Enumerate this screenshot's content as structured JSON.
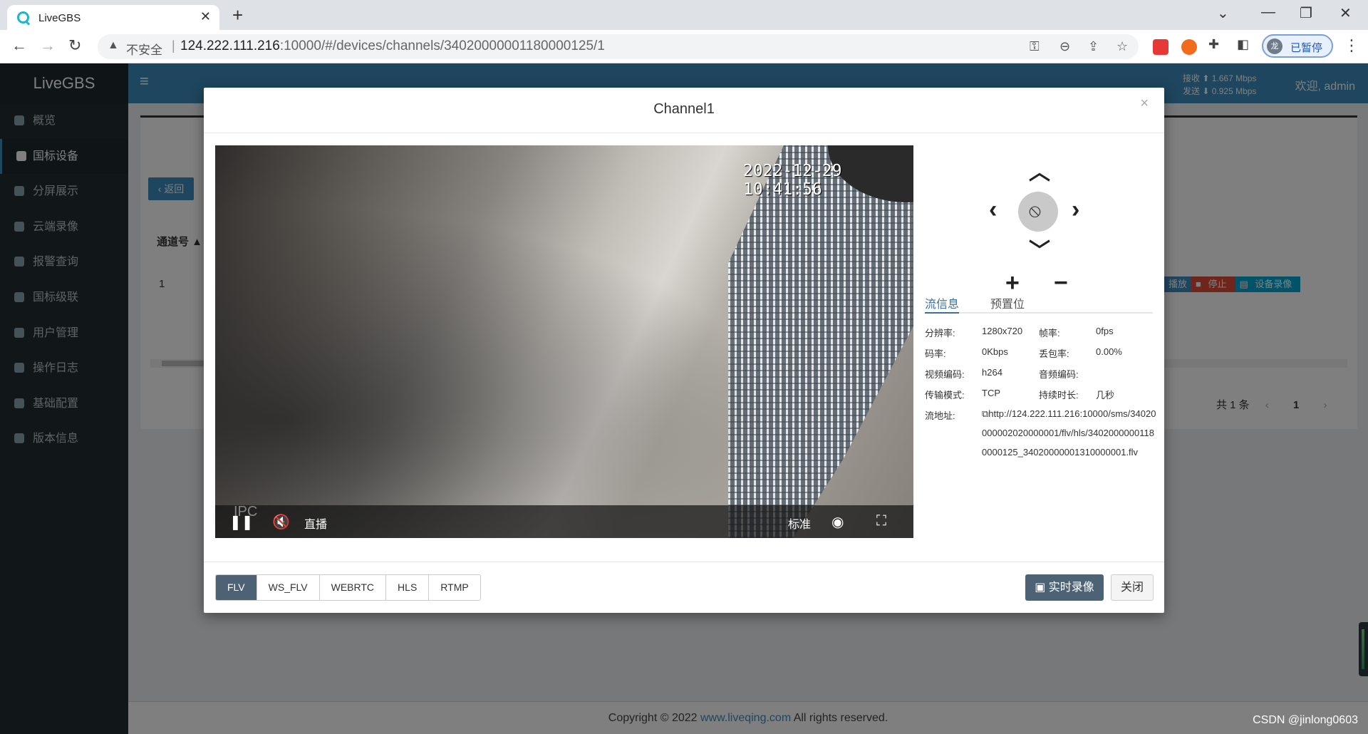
{
  "browser": {
    "tab_title": "LiveGBS",
    "insecure_label": "不安全",
    "url_host": "124.222.111.216",
    "url_rest": ":10000/#/devices/channels/34020000001180000125/1",
    "profile_initial": "龙",
    "profile_label": "已暂停"
  },
  "app": {
    "brand": "LiveGBS",
    "menu": [
      {
        "label": "概览",
        "icon": "dashboard-icon"
      },
      {
        "label": "国标设备",
        "icon": "video-camera-icon",
        "active": true
      },
      {
        "label": "分屏展示",
        "icon": "grid-icon"
      },
      {
        "label": "云端录像",
        "icon": "cloud-icon"
      },
      {
        "label": "报警查询",
        "icon": "bell-icon"
      },
      {
        "label": "国标级联",
        "icon": "cloud-upload-icon"
      },
      {
        "label": "用户管理",
        "icon": "users-icon"
      },
      {
        "label": "操作日志",
        "icon": "file-icon"
      },
      {
        "label": "基础配置",
        "icon": "cogs-icon"
      },
      {
        "label": "版本信息",
        "icon": "globe-icon"
      }
    ],
    "rate_recv": "接收 ⬆ 1.667 Mbps",
    "rate_send": "发送 ⬇ 0.925 Mbps",
    "welcome": "欢迎, admin",
    "back_label": "返回",
    "col_channel": "通道号",
    "row_num": "1",
    "act_play": "播放",
    "act_stop": "停止",
    "act_record": "设备录像",
    "pager_total": "共 1 条",
    "pager_page": "1",
    "footer_prefix": "Copyright © 2022",
    "footer_link": "www.liveqing.com",
    "footer_suffix": "All rights reserved.",
    "watermark": "CSDN @jinlong0603"
  },
  "modal": {
    "title": "Channel1",
    "close_x": "×",
    "osd_time": "2022-12-29 10:41:56",
    "osd_ipc": "IPC",
    "player": {
      "live_label": "直播",
      "quality_label": "标准"
    },
    "tabs": [
      {
        "label": "流信息",
        "active": true
      },
      {
        "label": "预置位"
      }
    ],
    "info": {
      "resolution_label": "分辨率:",
      "resolution": "1280x720",
      "fps_label": "帧率:",
      "fps": "0fps",
      "bitrate_label": "码率:",
      "bitrate": "0Kbps",
      "loss_label": "丢包率:",
      "loss": "0.00%",
      "vcodec_label": "视频编码:",
      "vcodec": "h264",
      "acodec_label": "音频编码:",
      "acodec": "",
      "transport_label": "传输模式:",
      "transport": "TCP",
      "duration_label": "持续时长:",
      "duration": "几秒",
      "addr_label": "流地址:",
      "addr": "http://124.222.111.216:10000/sms/34020000002020000001/flv/hls/34020000001180000125_34020000001310000001.flv"
    },
    "protocols": [
      "FLV",
      "WS_FLV",
      "WEBRTC",
      "HLS",
      "RTMP"
    ],
    "active_protocol": "FLV",
    "record_label": "实时录像",
    "close_label": "关闭"
  },
  "colors": {
    "accent": "#3c8dbc",
    "sidebar": "#222d32",
    "button_dark": "#4e6276"
  }
}
